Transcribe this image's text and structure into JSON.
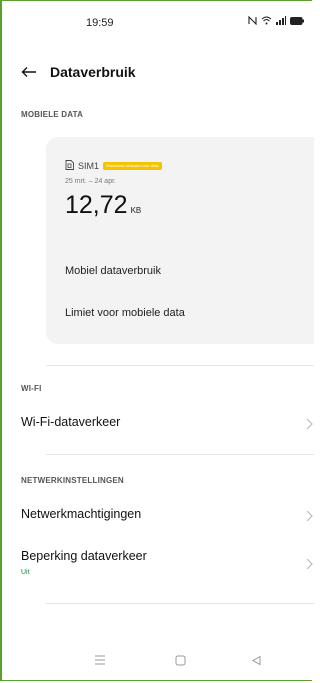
{
  "status": {
    "time": "19:59",
    "icons": [
      "nfc-icon",
      "wifi-icon",
      "signal-icon",
      "battery-icon"
    ]
  },
  "header": {
    "title": "Dataverbruik"
  },
  "mobile": {
    "section": "MOBIELE DATA",
    "sim": {
      "label": "SIM1",
      "badge": "Standaard simkaart voor data",
      "period": "25 mrt. – 24 apr.",
      "usage_value": "12,72",
      "usage_unit": "KB",
      "item_usage": "Mobiel dataverbruik",
      "item_limit": "Limiet voor mobiele data"
    }
  },
  "wifi": {
    "section": "WI-FI",
    "item": "Wi-Fi-dataverkeer"
  },
  "network": {
    "section": "NETWERKINSTELLINGEN",
    "permissions": "Netwerkmachtigingen",
    "restriction": "Beperking dataverkeer",
    "restriction_status": "Uit"
  },
  "colors": {
    "accent": "#1a8a4a",
    "badge": "#f5c400",
    "card_bg": "#f3f3f3"
  }
}
